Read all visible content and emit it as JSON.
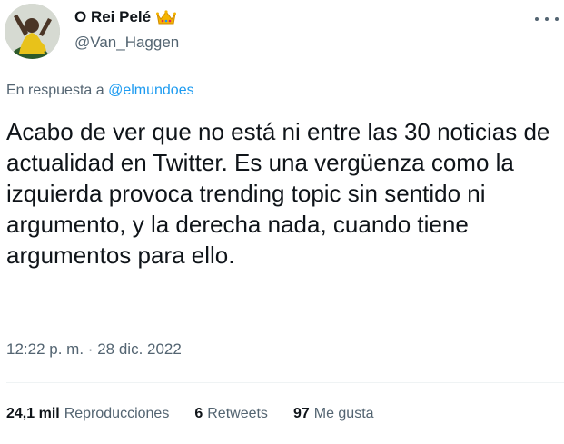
{
  "user": {
    "display_name": "O Rei Pelé",
    "handle": "@Van_Haggen",
    "badge_icon": "crown-emoji-icon",
    "badge_color": "#f5b400"
  },
  "menu": {
    "icon": "more-horizontal-icon"
  },
  "reply": {
    "prefix": "En respuesta a",
    "mention": "@elmundoes"
  },
  "tweet": {
    "text": "Acabo de ver que no está ni entre las 30 noticias de actualidad en Twitter. Es una vergüenza como la izquierda provoca trending topic sin sentido ni argumento, y la derecha nada, cuando tiene  argumentos para ello."
  },
  "meta": {
    "time": "12:22 p. m.",
    "separator": "·",
    "date": "28 dic. 2022"
  },
  "stats": {
    "views_count": "24,1 mil",
    "views_label": "Reproducciones",
    "retweets_count": "6",
    "retweets_label": "Retweets",
    "likes_count": "97",
    "likes_label": "Me gusta"
  },
  "colors": {
    "text": "#0f1419",
    "secondary": "#536471",
    "link": "#1d9bf0",
    "divider": "#eff3f4"
  }
}
